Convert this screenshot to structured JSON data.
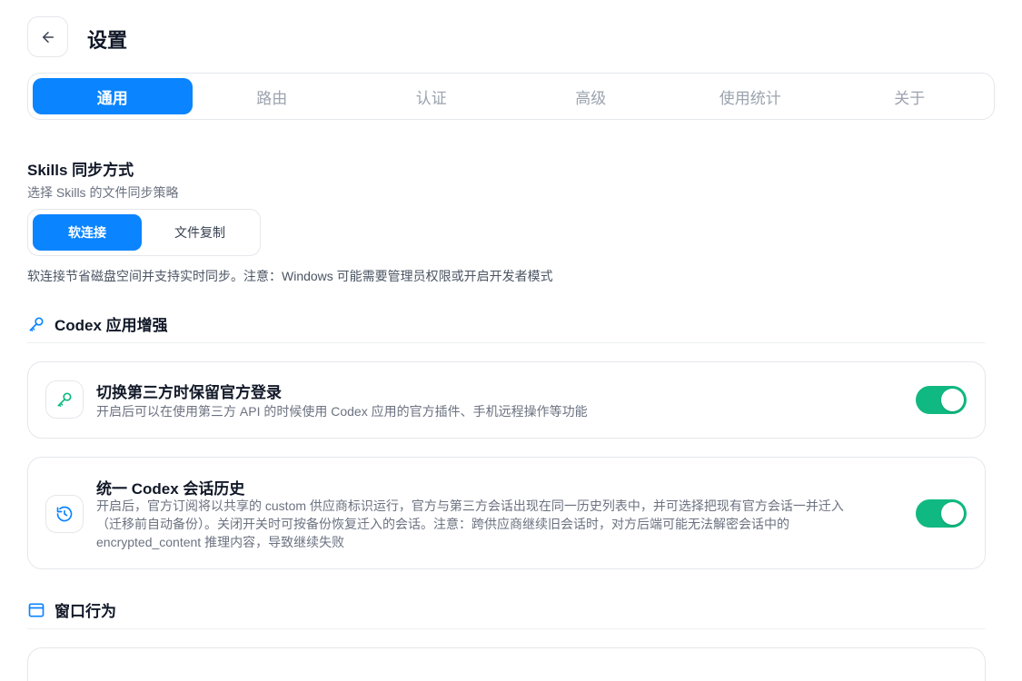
{
  "header": {
    "title": "设置",
    "back_icon": "arrow-left-icon"
  },
  "tabs": [
    {
      "label": "通用",
      "active": true
    },
    {
      "label": "路由",
      "active": false
    },
    {
      "label": "认证",
      "active": false
    },
    {
      "label": "高级",
      "active": false
    },
    {
      "label": "使用统计",
      "active": false
    },
    {
      "label": "关于",
      "active": false
    }
  ],
  "skills_sync": {
    "title": "Skills 同步方式",
    "subtitle": "选择 Skills 的文件同步策略",
    "options": [
      {
        "label": "软连接",
        "selected": true
      },
      {
        "label": "文件复制",
        "selected": false
      }
    ],
    "note": "软连接节省磁盘空间并支持实时同步。注意：Windows 可能需要管理员权限或开启开发者模式"
  },
  "codex_group": {
    "title": "Codex 应用增强",
    "icon": "key-icon",
    "items": [
      {
        "title": "切换第三方时保留官方登录",
        "desc": "开启后可以在使用第三方 API 的时候使用 Codex 应用的官方插件、手机远程操作等功能",
        "icon": "key-icon",
        "enabled": true
      },
      {
        "title": "统一 Codex 会话历史",
        "desc_lines": [
          "开启后，官方订阅将以共享的 custom 供应商标识运行，官方与第三方会话出现在同一历史列表中，并可选择把现有官方会话一并迁入",
          "（迁移前自动备份）。关闭开关时可按备份恢复迁入的会话。注意：跨供应商继续旧会话时，对方后端可能无法解密会话中的",
          "encrypted_content 推理内容，导致继续失败"
        ],
        "icon": "history-icon",
        "enabled": true
      }
    ]
  },
  "window_group": {
    "title": "窗口行为",
    "icon": "window-icon"
  },
  "colors": {
    "accent": "#0a84ff",
    "toggle_on": "#10b981"
  }
}
